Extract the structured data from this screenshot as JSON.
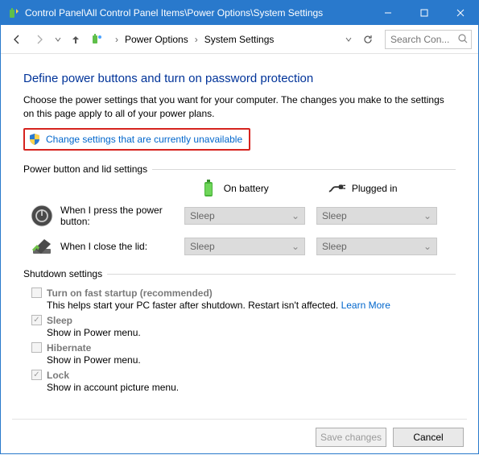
{
  "titlebar": {
    "title": "Control Panel\\All Control Panel Items\\Power Options\\System Settings"
  },
  "toolbar": {
    "crumb1": "Power Options",
    "crumb2": "System Settings",
    "search_placeholder": "Search Con..."
  },
  "page": {
    "heading": "Define power buttons and turn on password protection",
    "description": "Choose the power settings that you want for your computer. The changes you make to the settings on this page apply to all of your power plans.",
    "change_link": "Change settings that are currently unavailable"
  },
  "group1": {
    "label": "Power button and lid settings",
    "col_battery": "On battery",
    "col_plugged": "Plugged in",
    "row_power_btn": "When I press the power button:",
    "row_lid": "When I close the lid:",
    "val_power_btn_battery": "Sleep",
    "val_power_btn_plugged": "Sleep",
    "val_lid_battery": "Sleep",
    "val_lid_plugged": "Sleep"
  },
  "group2": {
    "label": "Shutdown settings",
    "items": [
      {
        "label": "Turn on fast startup (recommended)",
        "sub": "This helps start your PC faster after shutdown. Restart isn't affected. ",
        "learn": "Learn More"
      },
      {
        "label": "Sleep",
        "sub": "Show in Power menu."
      },
      {
        "label": "Hibernate",
        "sub": "Show in Power menu."
      },
      {
        "label": "Lock",
        "sub": "Show in account picture menu."
      }
    ]
  },
  "buttons": {
    "save": "Save changes",
    "cancel": "Cancel"
  }
}
